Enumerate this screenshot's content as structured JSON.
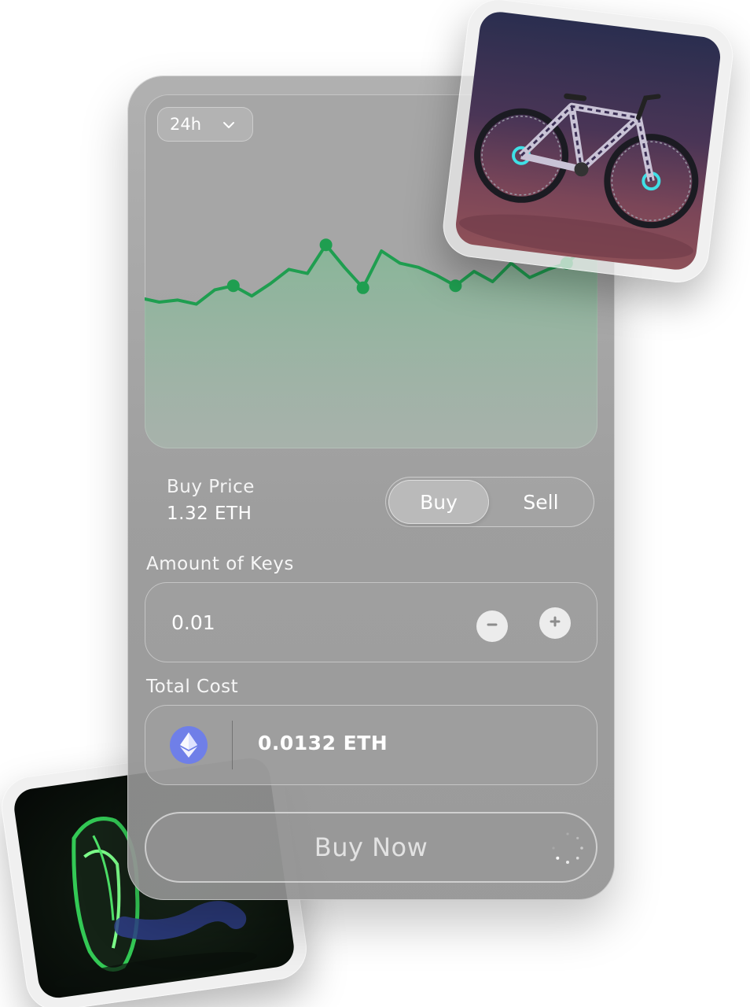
{
  "chart": {
    "period": "24h",
    "line_color": "#1f9e50",
    "fill_color": "#8fb9a0"
  },
  "chart_data": {
    "type": "area",
    "x": [
      0,
      1,
      2,
      3,
      4,
      5,
      6,
      7,
      8,
      9,
      10,
      11,
      12,
      13,
      14,
      15,
      16,
      17,
      18,
      19,
      20,
      21,
      22,
      23,
      24,
      25,
      26,
      27
    ],
    "values": [
      32,
      30,
      31,
      29,
      36,
      38,
      33,
      39,
      46,
      44,
      58,
      47,
      37,
      55,
      49,
      47,
      43,
      38,
      45,
      40,
      49,
      42,
      46,
      49,
      57,
      61,
      65,
      60
    ]
  },
  "trade": {
    "price_label": "Buy Price",
    "price_value": "1.32 ETH",
    "mode_buy": "Buy",
    "mode_sell": "Sell",
    "amount_label": "Amount of Keys",
    "amount_value": "0.01",
    "total_label": "Total Cost",
    "total_value": "0.0132 ETH",
    "buy_now_label": "Buy Now"
  },
  "colors": {
    "eth_badge": "#6f7fe8",
    "card": "#9c9c9c"
  },
  "icons": {
    "period": "chevron-down-icon",
    "minus": "minus-icon",
    "plus": "plus-icon",
    "currency": "ethereum-icon",
    "loading": "spinner-icon"
  }
}
